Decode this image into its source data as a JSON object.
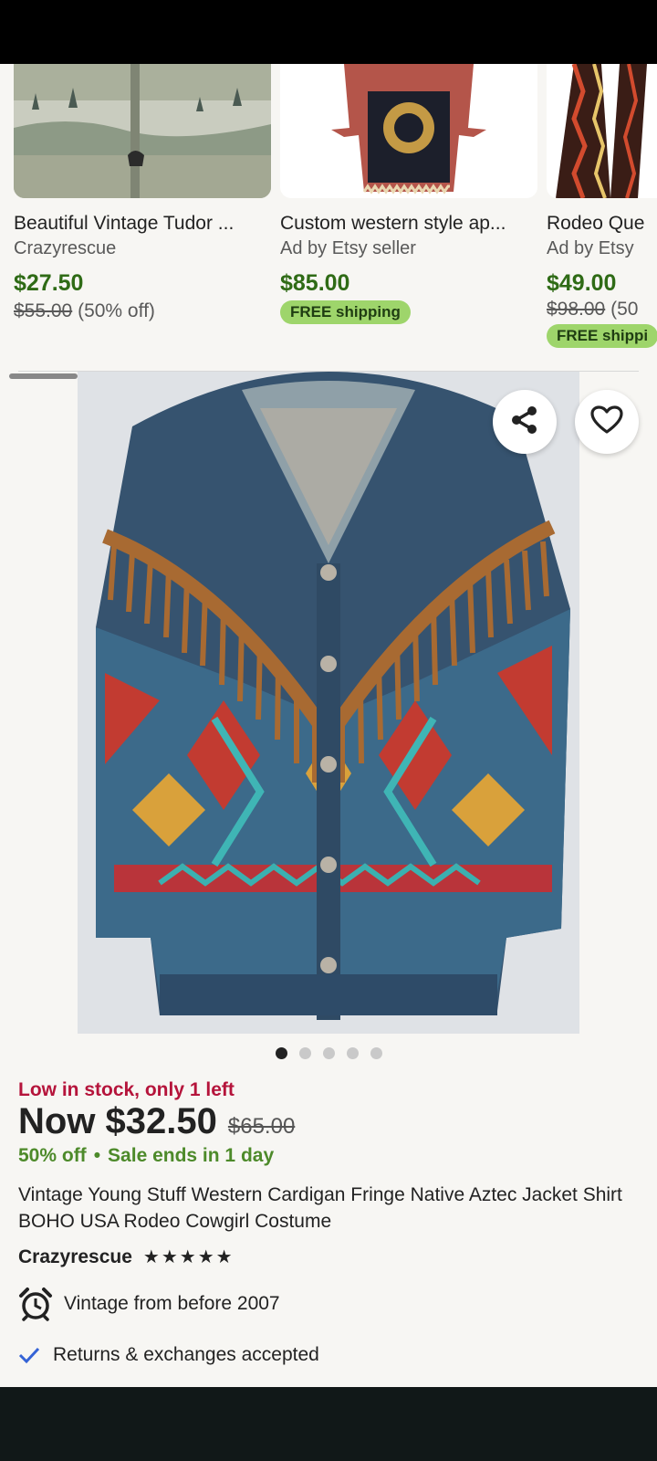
{
  "carousel": {
    "items": [
      {
        "title": "Beautiful Vintage Tudor ...",
        "seller": "Crazyrescue",
        "price": "$27.50",
        "original_price": "$55.00",
        "discount": "(50% off)",
        "shipping_badge": ""
      },
      {
        "title": "Custom western style ap...",
        "seller": "Ad by Etsy seller",
        "price": "$85.00",
        "original_price": "",
        "discount": "",
        "shipping_badge": "FREE shipping"
      },
      {
        "title": "Rodeo Que",
        "seller": "Ad by Etsy",
        "price": "$49.00",
        "original_price": "$98.00",
        "discount": "(50",
        "shipping_badge": "FREE shippi"
      }
    ]
  },
  "listing": {
    "image_count": 5,
    "active_image": 1,
    "stock_alert": "Low in stock, only 1 left",
    "price_now": "Now $32.50",
    "price_was": "$65.00",
    "discount": "50% off",
    "sale_timer": "Sale ends in 1 day",
    "title": "Vintage Young Stuff Western Cardigan Fringe Native Aztec Jacket Shirt BOHO USA Rodeo Cowgirl Costume",
    "shop_name": "Crazyrescue",
    "rating_stars": "★★★★★",
    "rating": 5,
    "vintage_note": "Vintage from before 2007",
    "returns_note": "Returns & exchanges accepted"
  },
  "icons": {
    "share": "share-icon",
    "favorite": "heart-icon",
    "alarm": "alarm-clock-icon",
    "check": "checkmark-icon"
  },
  "colors": {
    "sale_price": "#2f6b16",
    "stock_alert": "#b5143b",
    "sale_text": "#4d8a2a",
    "shipping_badge": "#9ed56b",
    "check": "#3563d6"
  }
}
